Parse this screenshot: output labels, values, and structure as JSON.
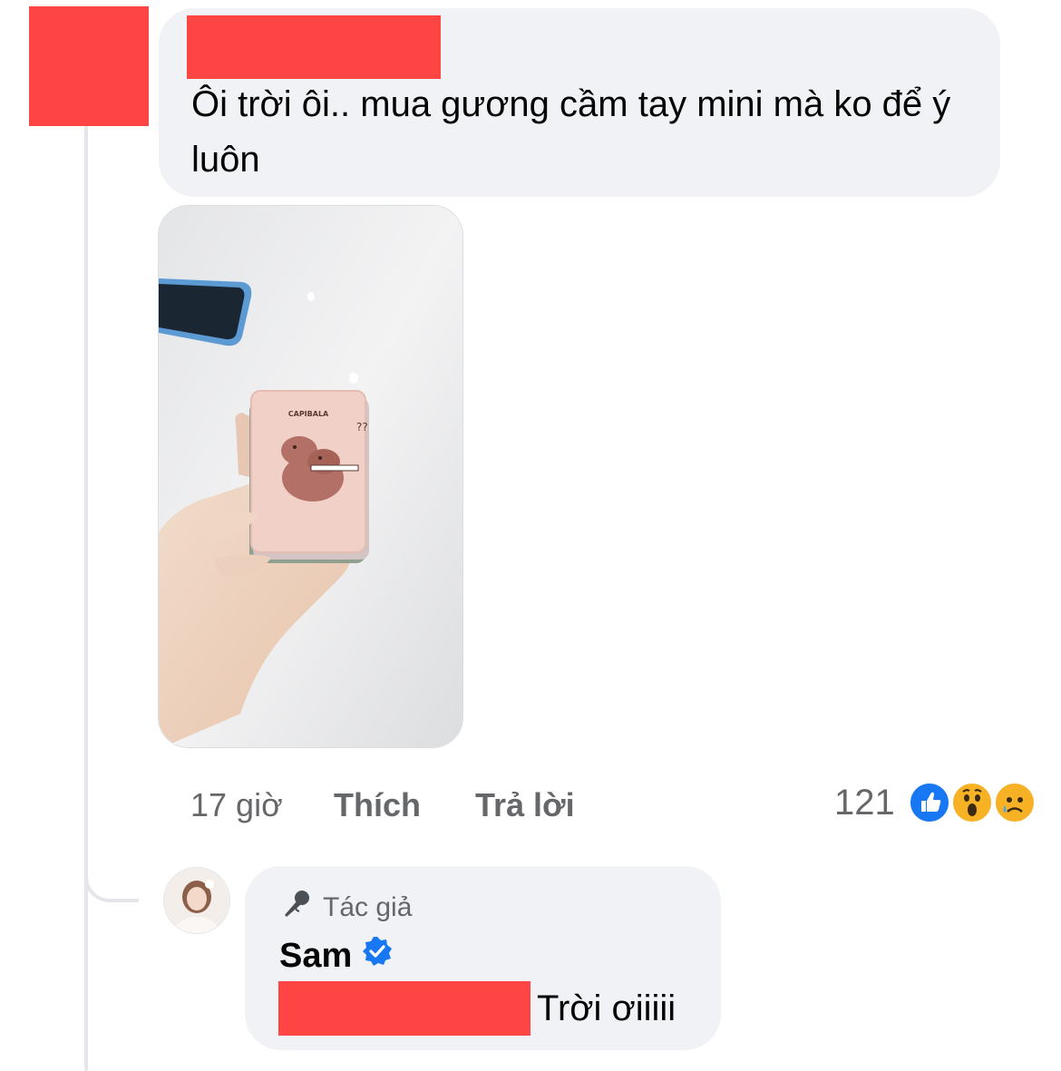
{
  "comment": {
    "text": "Ôi trời ôi..  mua gương cầm tay mini mà ko để ý luôn",
    "attachment": {
      "icon": "photo-image",
      "printed_text": "CAPIBALA"
    },
    "actions": {
      "time": "17 giờ",
      "like_label": "Thích",
      "reply_label": "Trả lời"
    },
    "reactions": {
      "count": "121",
      "types": [
        "like-icon",
        "wow-icon",
        "sad-icon"
      ]
    }
  },
  "reply": {
    "author_badge": "Tác giả",
    "author_name": "Sam",
    "verified_icon": "verified-badge-icon",
    "text": "Trời ơiiiii"
  },
  "colors": {
    "bubble": "#f0f2f5",
    "redaction": "#ff4444",
    "secondary_text": "#65676b",
    "like_blue": "#1877f2",
    "verified_blue": "#1877f2"
  }
}
